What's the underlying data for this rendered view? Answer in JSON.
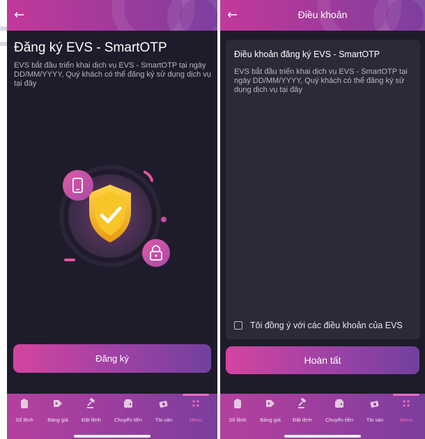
{
  "left_screen": {
    "page_title": "Đăng ký EVS - SmartOTP",
    "intro": "EVS bắt đầu triển khai dịch vụ EVS - SmartOTP tại ngày DD/MM/YYYY, Quý khách có thể đăng ký sử dụng dịch vụ tại đây",
    "register_button": "Đăng ký",
    "illustration_icons": [
      "phone-icon",
      "shield-check-icon",
      "lock-icon"
    ]
  },
  "right_screen": {
    "header_title": "Điều khoản",
    "terms_title": "Điều khoản đăng ký EVS - SmartOTP",
    "terms_body": "EVS bắt đầu triển khai dịch vụ EVS - SmartOTP tại ngày DD/MM/YYYY, Quý khách có thể đăng ký sử dụng dịch vụ tại đây",
    "agree_label": "Tôi đồng ý với các điều khoản của EVS",
    "agree_checked": false,
    "done_button": "Hoàn tất"
  },
  "tabbar": {
    "tabs": [
      {
        "label": "Sổ lệnh",
        "icon": "clipboard-icon"
      },
      {
        "label": "Bảng giá",
        "icon": "tag-icon"
      },
      {
        "label": "Đặt lệnh",
        "icon": "gavel-icon"
      },
      {
        "label": "Chuyển tiền",
        "icon": "wallet-icon"
      },
      {
        "label": "Tài sản",
        "icon": "money-icon"
      },
      {
        "label": "Menu",
        "icon": "grid-icon",
        "active": true
      }
    ]
  },
  "colors": {
    "background": "#1e1c2a",
    "card": "#2b2a38",
    "accent_pink": "#d4449f",
    "accent_purple": "#71409f",
    "shield_gold": "#f4b400"
  }
}
